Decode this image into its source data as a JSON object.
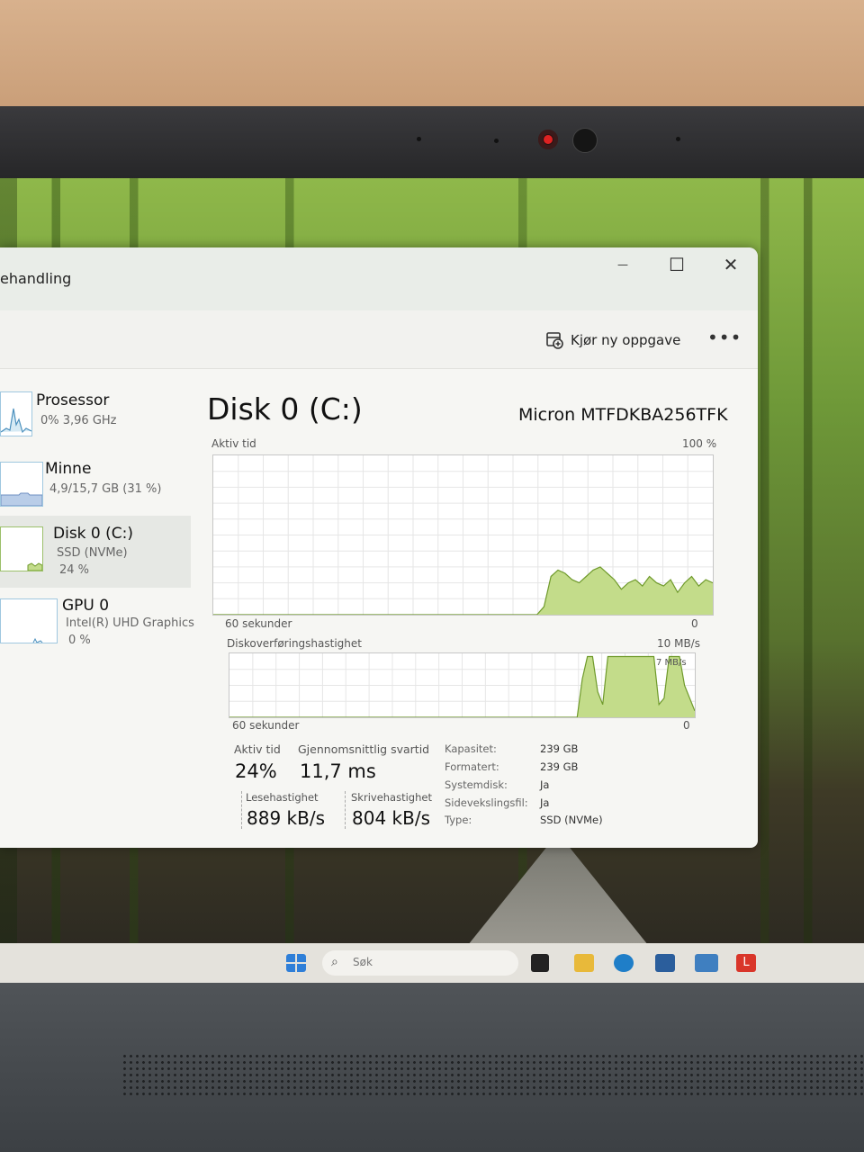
{
  "window": {
    "title": "ehandling",
    "controls": {
      "minimize": "—",
      "maximize": "☐",
      "close": "✕"
    }
  },
  "commandbar": {
    "run_task_label": "Kjør ny oppgave",
    "run_task_icon": "run-task-icon",
    "more_label": "•••"
  },
  "sidebar": {
    "items": [
      {
        "name": "Prosessor",
        "detail": "0% 3,96 GHz"
      },
      {
        "name": "Minne",
        "detail": "4,9/15,7 GB (31 %)"
      },
      {
        "name": "Disk 0 (C:)",
        "detail": "SSD (NVMe)",
        "detail2": "24 %",
        "selected": true
      },
      {
        "name": "GPU 0",
        "detail": "Intel(R) UHD Graphics",
        "detail2": "0 %"
      }
    ]
  },
  "main": {
    "title": "Disk 0 (C:)",
    "model": "Micron MTFDKBA256TFK",
    "graph1": {
      "label": "Aktiv tid",
      "max_label": "100 %",
      "time_label": "60 sekunder",
      "min_label": "0",
      "values": [
        0,
        0,
        0,
        0,
        0,
        0,
        0,
        0,
        0,
        0,
        0,
        0,
        0,
        0,
        0,
        0,
        0,
        0,
        0,
        0,
        0,
        0,
        0,
        0,
        0,
        0,
        0,
        0,
        0,
        0,
        0,
        0,
        0,
        0,
        0,
        0,
        0,
        0,
        0,
        0,
        0,
        0,
        0,
        0,
        0,
        0,
        0,
        5,
        24,
        28,
        26,
        22,
        20,
        24,
        28,
        30,
        26,
        22,
        16,
        20,
        22,
        18,
        24,
        20,
        18,
        22,
        14,
        20,
        24,
        18,
        22,
        20
      ]
    },
    "graph2": {
      "label": "Diskoverføringshastighet",
      "max_label": "10 MB/s",
      "secondary_label": "7 MB/s",
      "time_label": "60 sekunder",
      "min_label": "0",
      "values": [
        0,
        0,
        0,
        0,
        0,
        0,
        0,
        0,
        0,
        0,
        0,
        0,
        0,
        0,
        0,
        0,
        0,
        0,
        0,
        0,
        0,
        0,
        0,
        0,
        0,
        0,
        0,
        0,
        0,
        0,
        0,
        0,
        0,
        0,
        0,
        0,
        0,
        0,
        0,
        0,
        0,
        0,
        0,
        0,
        0,
        0,
        0,
        0,
        0,
        0,
        0,
        0,
        0,
        0,
        0,
        0,
        0,
        0,
        0,
        0,
        0,
        0,
        0,
        0,
        0,
        0,
        0,
        0,
        0,
        6,
        9.5,
        9.5,
        4,
        2,
        9.5,
        9.5,
        9.5,
        9.5,
        9.5,
        9.5,
        9.5,
        9.5,
        9.5,
        9.5,
        2,
        3,
        9.5,
        9.5,
        9.5,
        5,
        3,
        1
      ]
    },
    "stats": {
      "active_time_label": "Aktiv tid",
      "active_time": "24%",
      "avg_response_label": "Gjennomsnittlig svartid",
      "avg_response": "11,7 ms",
      "read_label": "Lesehastighet",
      "read": "889 kB/s",
      "write_label": "Skrivehastighet",
      "write": "804 kB/s"
    },
    "props": [
      {
        "k": "Kapasitet:",
        "v": "239 GB"
      },
      {
        "k": "Formatert:",
        "v": "239 GB"
      },
      {
        "k": "Systemdisk:",
        "v": "Ja"
      },
      {
        "k": "Sidevekslingsfil:",
        "v": "Ja"
      },
      {
        "k": "Type:",
        "v": "SSD (NVMe)"
      }
    ]
  },
  "taskbar": {
    "search_placeholder": "Søk",
    "accent": "#3a86d6"
  },
  "colors": {
    "graph_fill": "#c3dc8a",
    "graph_line": "#6f9a2b",
    "accent_blue": "#8bbbd8"
  }
}
